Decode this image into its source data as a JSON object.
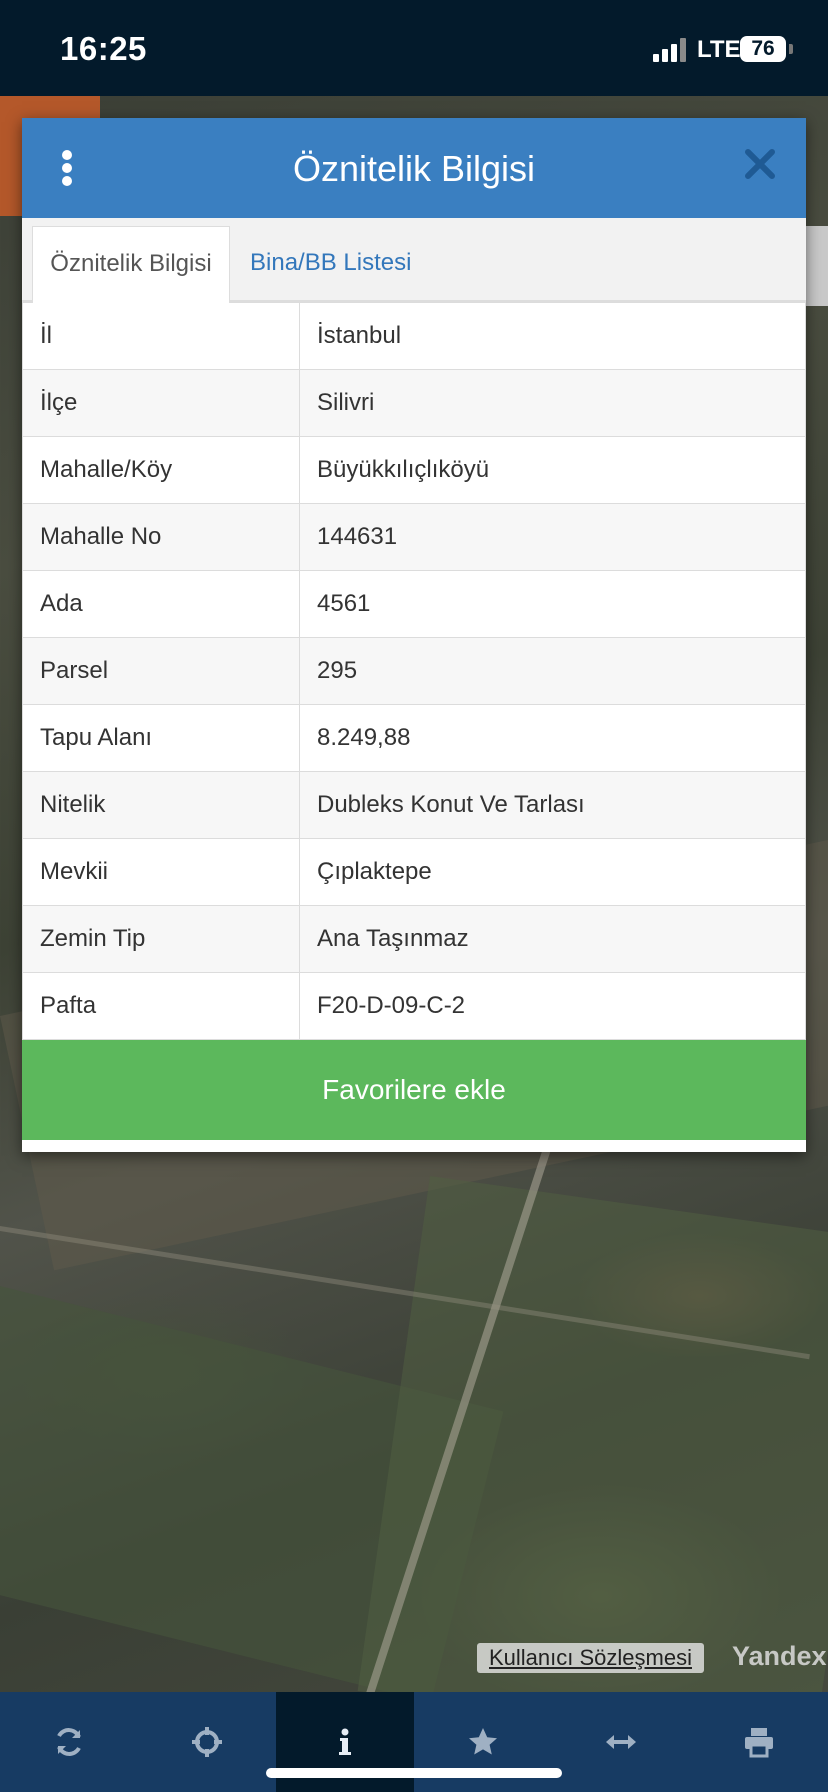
{
  "status_bar": {
    "time": "16:25",
    "network": "LTE",
    "battery": "76"
  },
  "modal": {
    "title": "Öznitelik Bilgisi",
    "tabs": [
      {
        "label": "Öznitelik Bilgisi",
        "active": true
      },
      {
        "label": "Bina/BB Listesi",
        "active": false
      }
    ],
    "rows": [
      {
        "key": "İl",
        "value": "İstanbul"
      },
      {
        "key": "İlçe",
        "value": "Silivri"
      },
      {
        "key": "Mahalle/Köy",
        "value": "Büyükkılıçlıköyü"
      },
      {
        "key": "Mahalle No",
        "value": "144631"
      },
      {
        "key": "Ada",
        "value": "4561"
      },
      {
        "key": "Parsel",
        "value": "295"
      },
      {
        "key": "Tapu Alanı",
        "value": "8.249,88"
      },
      {
        "key": "Nitelik",
        "value": "Dubleks Konut Ve Tarlası"
      },
      {
        "key": "Mevkii",
        "value": "Çıplaktepe"
      },
      {
        "key": "Zemin Tip",
        "value": "Ana Taşınmaz"
      },
      {
        "key": "Pafta",
        "value": "F20-D-09-C-2"
      }
    ],
    "favorite_button": "Favorilere ekle"
  },
  "map": {
    "attribution_link": "Kullanıcı Sözleşmesi",
    "provider": "Yandex"
  },
  "toolbar": {
    "items": [
      {
        "icon": "refresh-icon",
        "active": false
      },
      {
        "icon": "locate-icon",
        "active": false
      },
      {
        "icon": "info-icon",
        "active": true
      },
      {
        "icon": "star-icon",
        "active": false
      },
      {
        "icon": "measure-icon",
        "active": false
      },
      {
        "icon": "print-icon",
        "active": false
      }
    ]
  },
  "colors": {
    "header": "#3a7fc1",
    "favorite_button": "#5cb85c",
    "toolbar": "#173b63",
    "status_bar": "#031a2b"
  }
}
